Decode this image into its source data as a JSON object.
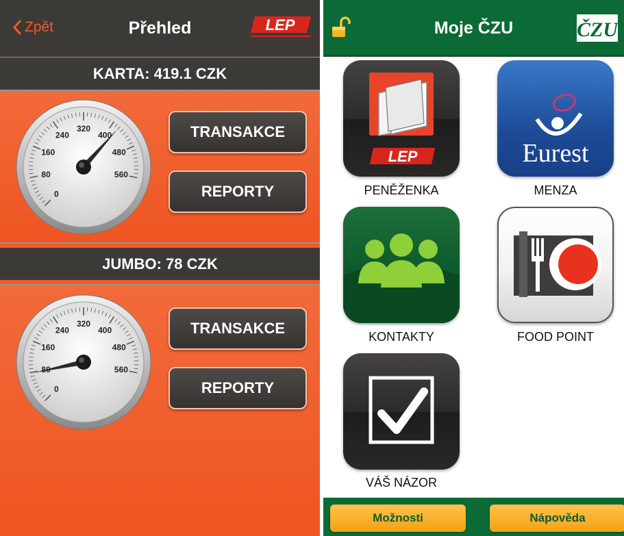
{
  "left": {
    "back_label": "Zpět",
    "title": "Přehled",
    "logo_text": "LEP",
    "cards": [
      {
        "label": "KARTA: 419.1 CZK",
        "balance": 419.1,
        "transactions_label": "TRANSAKCE",
        "reports_label": "REPORTY"
      },
      {
        "label": "JUMBO: 78 CZK",
        "balance": 78,
        "transactions_label": "TRANSAKCE",
        "reports_label": "REPORTY"
      }
    ],
    "gauge_ticks": [
      "0",
      "80",
      "160",
      "240",
      "320",
      "400",
      "480",
      "560"
    ],
    "colors": {
      "accent": "#ef5a27",
      "bar": "#3c3a37"
    }
  },
  "right": {
    "title": "Moje ČZU",
    "logo_text": "ČZU",
    "apps": [
      {
        "label": "PENĚŽENKA",
        "icon": "wallet-icon",
        "logo_text": "LEP"
      },
      {
        "label": "MENZA",
        "icon": "eurest-icon",
        "logo_text": "Eurest"
      },
      {
        "label": "KONTAKTY",
        "icon": "people-icon"
      },
      {
        "label": "FOOD POINT",
        "icon": "food-point-icon"
      },
      {
        "label": "VÁŠ NÁZOR",
        "icon": "checkmark-icon"
      }
    ],
    "footer": {
      "options_label": "Možnosti",
      "help_label": "Nápověda"
    },
    "colors": {
      "brand": "#0b6a35",
      "button": "#f7b02a"
    }
  }
}
